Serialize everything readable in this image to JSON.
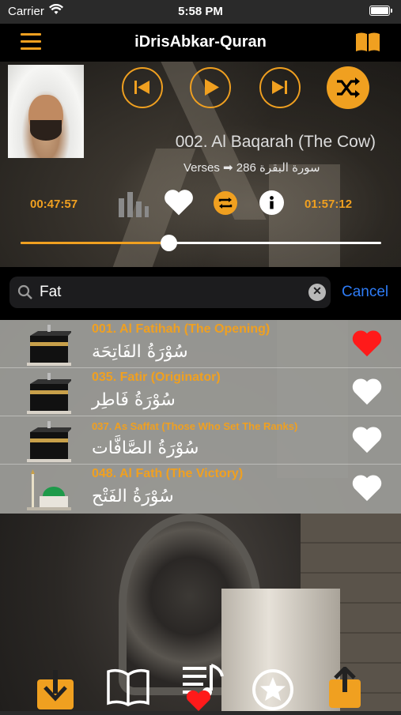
{
  "status_bar": {
    "carrier": "Carrier",
    "time": "5:58 PM"
  },
  "nav": {
    "title": "iDrisAbkar-Quran"
  },
  "player": {
    "track_title": "002. Al Baqarah (The Cow)",
    "verses_label": "Verses",
    "verses_count": "286",
    "surah_arabic": "سورة البقرة",
    "elapsed": "00:47:57",
    "duration": "01:57:12",
    "progress": 0.41,
    "favorited": false
  },
  "search": {
    "query": "Fat",
    "cancel_label": "Cancel"
  },
  "results": [
    {
      "title": "001. Al Fatihah (The Opening)",
      "arabic": "سُوْرَةُ الفَاتِحَة",
      "favorite": true,
      "thumb": "kaaba",
      "small": false
    },
    {
      "title": "035. Fatir (Originator)",
      "arabic": "سُوْرَةُ فَاطِر",
      "favorite": false,
      "thumb": "kaaba",
      "small": false
    },
    {
      "title": "037. As Saffat (Those Who Set The Ranks)",
      "arabic": "سُوْرَةُ الصَّافَّات",
      "favorite": false,
      "thumb": "kaaba",
      "small": true
    },
    {
      "title": "048. Al Fath (The Victory)",
      "arabic": "سُوْرَةُ الفَتْح",
      "favorite": false,
      "thumb": "mosque",
      "small": false
    }
  ],
  "tabbar": [
    "download-icon",
    "book-open-icon",
    "playlist-heart-icon",
    "star-circle-icon",
    "share-icon"
  ],
  "colors": {
    "accent": "#f0a020",
    "link": "#2e7cf6",
    "favorite": "#ff1a1a"
  }
}
